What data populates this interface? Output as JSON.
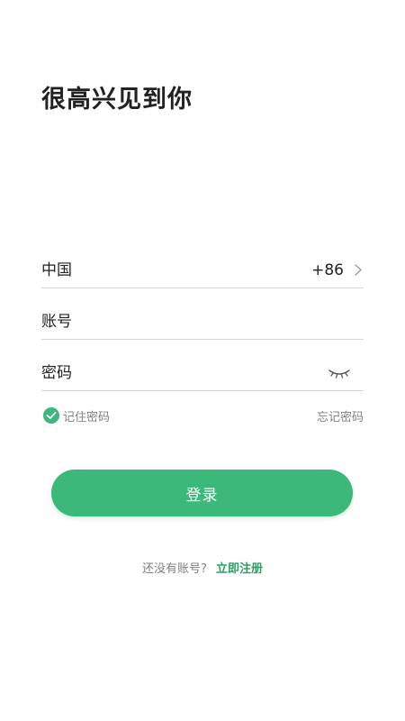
{
  "header": {
    "title": "很高兴见到你"
  },
  "form": {
    "country": {
      "label": "中国",
      "code": "+86",
      "icon": "chevron-right-icon"
    },
    "account": {
      "placeholder": "账号",
      "value": ""
    },
    "password": {
      "placeholder": "密码",
      "value": "",
      "toggle_icon": "eye-closed-icon"
    },
    "remember": {
      "label": "记住密码",
      "checked": true,
      "icon": "check-circle-icon"
    },
    "forgot_label": "忘记密码",
    "submit_label": "登录"
  },
  "footer": {
    "prompt": "还没有账号?",
    "register_label": "立即注册"
  },
  "colors": {
    "accent": "#3bb87a",
    "link": "#2e9e64",
    "text": "#222222",
    "muted": "#808080",
    "divider": "#d6d6d6"
  }
}
